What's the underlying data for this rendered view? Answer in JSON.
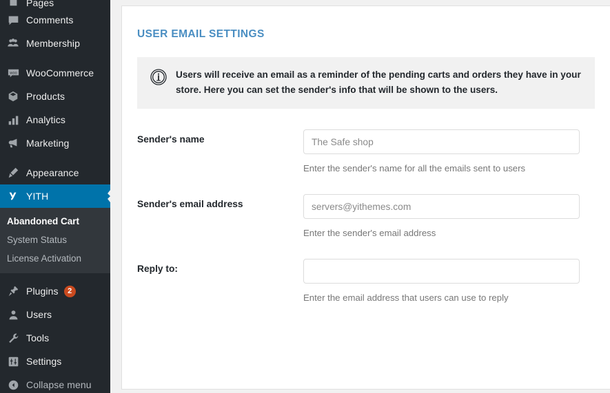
{
  "sidebar": {
    "items": [
      {
        "label": "Pages",
        "icon": "pages-icon",
        "partial": true
      },
      {
        "label": "Comments",
        "icon": "comments-icon"
      },
      {
        "label": "Membership",
        "icon": "membership-icon"
      },
      {
        "separator": true
      },
      {
        "label": "WooCommerce",
        "icon": "woocommerce-icon"
      },
      {
        "label": "Products",
        "icon": "products-icon"
      },
      {
        "label": "Analytics",
        "icon": "analytics-icon"
      },
      {
        "label": "Marketing",
        "icon": "marketing-icon"
      },
      {
        "separator": true
      },
      {
        "label": "Appearance",
        "icon": "appearance-icon"
      },
      {
        "label": "YITH",
        "icon": "yith-icon",
        "current": true
      }
    ],
    "submenu": [
      {
        "label": "Abandoned Cart",
        "active": true
      },
      {
        "label": "System Status"
      },
      {
        "label": "License Activation"
      }
    ],
    "items_bottom": [
      {
        "label": "Plugins",
        "icon": "plugins-icon",
        "badge": "2"
      },
      {
        "label": "Users",
        "icon": "users-icon"
      },
      {
        "label": "Tools",
        "icon": "tools-icon"
      },
      {
        "label": "Settings",
        "icon": "settings-icon"
      }
    ],
    "collapse": {
      "label": "Collapse menu",
      "icon": "collapse-icon"
    },
    "accent_color": "#0073aa",
    "badge_color": "#ca4a1f"
  },
  "main": {
    "title": "USER EMAIL SETTINGS",
    "title_color": "#4a8ec2",
    "notice": {
      "icon": "info-icon",
      "text": "Users will receive an email as a reminder of the pending carts and orders they have in your store. Here you can set the sender's info that will be shown to the users."
    },
    "fields": [
      {
        "label": "Sender's name",
        "value": "The Safe shop",
        "placeholder": "",
        "description": "Enter the sender's name for all the emails sent to users"
      },
      {
        "label": "Sender's email address",
        "value": "servers@yithemes.com",
        "placeholder": "",
        "description": "Enter the sender's email address"
      },
      {
        "label": "Reply to:",
        "value": "",
        "placeholder": "",
        "description": "Enter the email address that users can use to reply"
      }
    ]
  }
}
